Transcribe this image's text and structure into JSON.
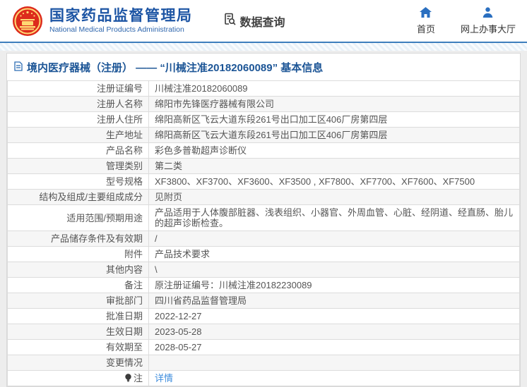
{
  "header": {
    "agency_name_cn": "国家药品监督管理局",
    "agency_name_en": "National Medical Products Administration",
    "data_query_label": "数据查询",
    "nav": [
      {
        "label": "首页",
        "icon": "home-icon"
      },
      {
        "label": "网上办事大厅",
        "icon": "person-icon"
      }
    ]
  },
  "page_title": "境内医疗器械（注册） —— “川械注准20182060089” 基本信息",
  "detail_table": {
    "rows": [
      {
        "label": "注册证编号",
        "value": "川械注准20182060089"
      },
      {
        "label": "注册人名称",
        "value": "绵阳市先锋医疗器械有限公司"
      },
      {
        "label": "注册人住所",
        "value": "绵阳高新区飞云大道东段261号出口加工区406厂房第四层"
      },
      {
        "label": "生产地址",
        "value": "绵阳高新区飞云大道东段261号出口加工区406厂房第四层"
      },
      {
        "label": "产品名称",
        "value": "彩色多普勒超声诊断仪"
      },
      {
        "label": "管理类别",
        "value": "第二类"
      },
      {
        "label": "型号规格",
        "value": "XF3800、XF3700、XF3600、XF3500 , XF7800、XF7700、XF7600、XF7500"
      },
      {
        "label": "结构及组成/主要组成成分",
        "value": "见附页"
      },
      {
        "label": "适用范围/预期用途",
        "value": "产品适用于人体腹部脏器、浅表组织、小器官、外周血管、心脏、经阴道、经直肠、胎儿的超声诊断检查。"
      },
      {
        "label": "产品储存条件及有效期",
        "value": "/"
      },
      {
        "label": "附件",
        "value": "产品技术要求"
      },
      {
        "label": "其他内容",
        "value": "\\"
      },
      {
        "label": "备注",
        "value": "原注册证编号：川械注准20182230089"
      },
      {
        "label": "审批部门",
        "value": "四川省药品监督管理局"
      },
      {
        "label": "批准日期",
        "value": "2022-12-27"
      },
      {
        "label": "生效日期",
        "value": "2023-05-28"
      },
      {
        "label": "有效期至",
        "value": "2028-05-27"
      },
      {
        "label": "变更情况",
        "value": ""
      },
      {
        "label": "注",
        "label_icon": "bulb-icon",
        "value": "详情",
        "value_type": "link"
      }
    ]
  },
  "colors": {
    "title_blue": "#1c5596",
    "icon_blue": "#2a6fc0",
    "link_blue": "#3e8ddd",
    "emblem_red": "#dd2b1c",
    "emblem_gold": "#ffd873",
    "header_rule_blue": "#3d7ebd"
  }
}
